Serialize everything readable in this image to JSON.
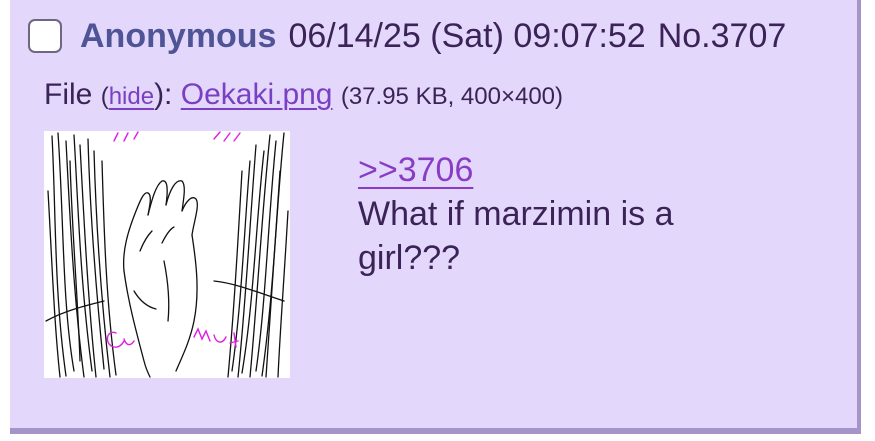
{
  "post": {
    "name": "Anonymous",
    "datetime": "06/14/25 (Sat) 09:07:52",
    "number": "No.3707",
    "file": {
      "label": "File",
      "hide_open": "(",
      "hide_label": "hide",
      "hide_close": "):",
      "filename": "Oekaki.png",
      "size_info": "(37.95 KB, 400×400)"
    },
    "quote_link": ">>3706",
    "message_lines": [
      "What if marzimin is a",
      "girl???"
    ]
  },
  "colors": {
    "post_background": "#e3d8fb",
    "name": "#4f5496",
    "link": "#7a3fc2",
    "text": "#3b2357",
    "border": "#a494c8"
  }
}
